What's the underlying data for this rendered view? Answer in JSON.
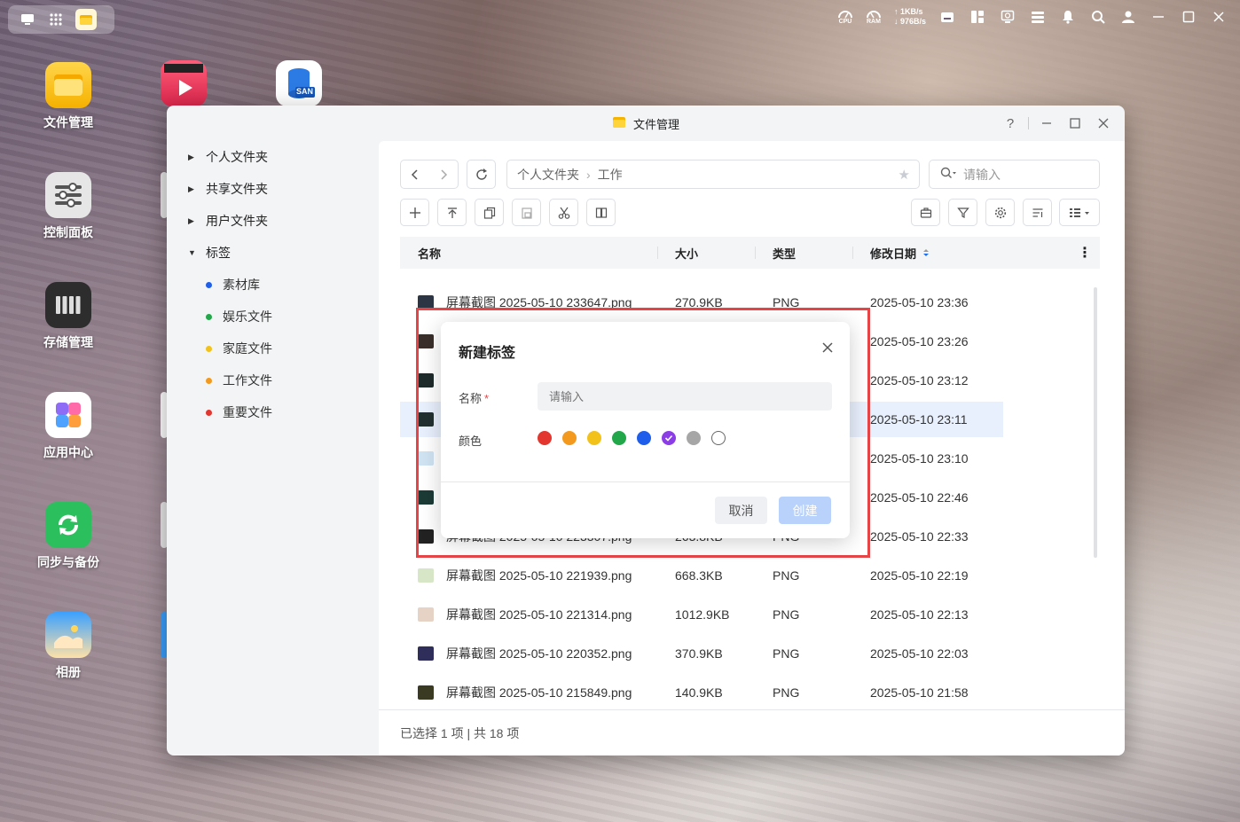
{
  "topbar": {
    "cpu_label": "CPU",
    "ram_label": "RAM",
    "upload": "↑ 1KB/s",
    "download": "↓ 976B/s"
  },
  "desktop": {
    "items": [
      {
        "label": "文件管理"
      },
      {
        "label": "控制面板"
      },
      {
        "label": "存储管理"
      },
      {
        "label": "应用中心"
      },
      {
        "label": "同步与备份"
      },
      {
        "label": "相册"
      }
    ],
    "san_label": "SAN"
  },
  "window": {
    "title": "文件管理",
    "help_icon": "?",
    "sidebar": {
      "folders": [
        {
          "label": "个人文件夹"
        },
        {
          "label": "共享文件夹"
        },
        {
          "label": "用户文件夹"
        },
        {
          "label": "标签"
        }
      ],
      "tags": [
        {
          "label": "素材库",
          "color": "#1e5eea"
        },
        {
          "label": "娱乐文件",
          "color": "#22a84a"
        },
        {
          "label": "家庭文件",
          "color": "#f2c21b"
        },
        {
          "label": "工作文件",
          "color": "#f39a1e"
        },
        {
          "label": "重要文件",
          "color": "#e2362e"
        }
      ]
    },
    "breadcrumb": {
      "root": "个人文件夹",
      "separator": "›",
      "current": "工作"
    },
    "search_placeholder": "请输入",
    "table": {
      "columns": [
        "名称",
        "大小",
        "类型",
        "修改日期"
      ],
      "rows": [
        {
          "name": "屏幕截图 2025-05-10 233647.png",
          "size": "270.9KB",
          "type": "PNG",
          "date": "2025-05-10 23:36",
          "thumb": "#2b3544"
        },
        {
          "name": "",
          "size": "",
          "type": "",
          "date": "2025-05-10 23:26",
          "thumb": "#3a2e2a"
        },
        {
          "name": "",
          "size": "",
          "type": "",
          "date": "2025-05-10 23:12",
          "thumb": "#1f2a2a"
        },
        {
          "name": "",
          "size": "",
          "type": "",
          "date": "2025-05-10 23:11",
          "thumb": "#233030"
        },
        {
          "name": "",
          "size": "",
          "type": "",
          "date": "2025-05-10 23:10",
          "thumb": "#cfe3f3"
        },
        {
          "name": "",
          "size": "",
          "type": "",
          "date": "2025-05-10 22:46",
          "thumb": "#1c3a36"
        },
        {
          "name": "屏幕截图 2025-05-10 223307.png",
          "size": "263.8KB",
          "type": "PNG",
          "date": "2025-05-10 22:33",
          "thumb": "#222222"
        },
        {
          "name": "屏幕截图 2025-05-10 221939.png",
          "size": "668.3KB",
          "type": "PNG",
          "date": "2025-05-10 22:19",
          "thumb": "#d8e6c8"
        },
        {
          "name": "屏幕截图 2025-05-10 221314.png",
          "size": "1012.9KB",
          "type": "PNG",
          "date": "2025-05-10 22:13",
          "thumb": "#e7d3c6"
        },
        {
          "name": "屏幕截图 2025-05-10 220352.png",
          "size": "370.9KB",
          "type": "PNG",
          "date": "2025-05-10 22:03",
          "thumb": "#2f2d5a"
        },
        {
          "name": "屏幕截图 2025-05-10 215849.png",
          "size": "140.9KB",
          "type": "PNG",
          "date": "2025-05-10 21:58",
          "thumb": "#3a3a22"
        }
      ]
    },
    "footer": "已选择 1 项 | 共 18 项"
  },
  "dialog": {
    "title": "新建标签",
    "name_label": "名称",
    "required_mark": "*",
    "name_placeholder": "请输入",
    "color_label": "颜色",
    "colors": [
      "#e2362e",
      "#f39a1e",
      "#f2c21b",
      "#22a84a",
      "#1e5eea",
      "#8b3ee6",
      "#a6a6a6",
      "#ffffff"
    ],
    "selected_color": "#8b3ee6",
    "cancel": "取消",
    "create": "创建"
  }
}
